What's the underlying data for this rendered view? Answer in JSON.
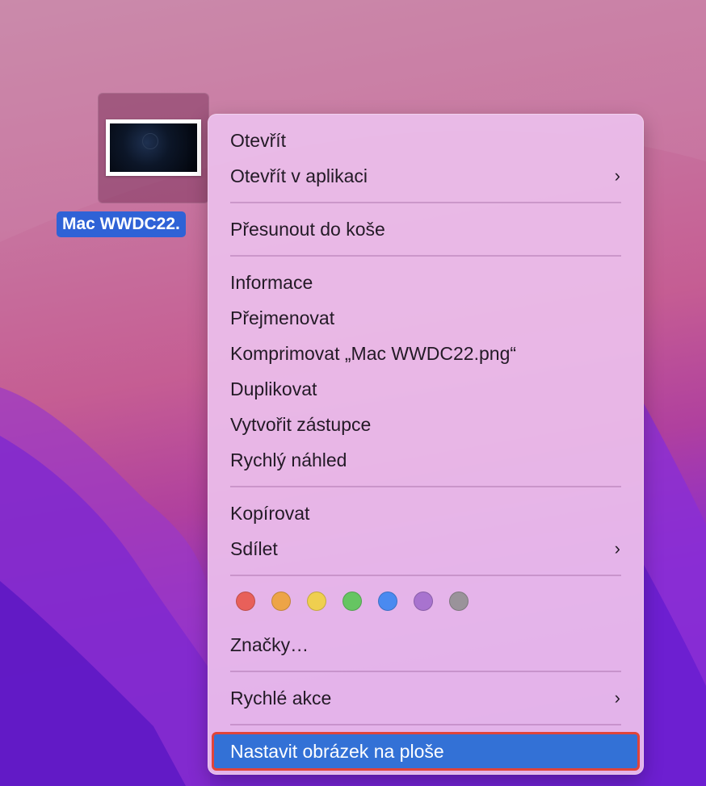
{
  "desktop": {
    "file_label": "Mac WWDC22."
  },
  "menu": {
    "items": [
      {
        "label": "Otevřít"
      },
      {
        "label": "Otevřít v aplikaci",
        "submenu": true
      },
      {
        "label": "Přesunout do koše"
      },
      {
        "label": "Informace"
      },
      {
        "label": "Přejmenovat"
      },
      {
        "label": "Komprimovat „Mac WWDC22.png“"
      },
      {
        "label": "Duplikovat"
      },
      {
        "label": "Vytvořit zástupce"
      },
      {
        "label": "Rychlý náhled"
      },
      {
        "label": "Kopírovat"
      },
      {
        "label": "Sdílet",
        "submenu": true
      },
      {
        "label": "Značky…"
      },
      {
        "label": "Rychlé akce",
        "submenu": true
      },
      {
        "label": "Nastavit obrázek na ploše",
        "highlighted": true
      }
    ],
    "chevron": "›",
    "tag_colors": [
      {
        "name": "red",
        "color": "#e8605a"
      },
      {
        "name": "orange",
        "color": "#eda447"
      },
      {
        "name": "yellow",
        "color": "#efcf4f"
      },
      {
        "name": "green",
        "color": "#66c562"
      },
      {
        "name": "blue",
        "color": "#4a8af0"
      },
      {
        "name": "purple",
        "color": "#a873cf"
      },
      {
        "name": "gray",
        "color": "#9a939a"
      }
    ],
    "highlight_color": "#3371d6"
  }
}
